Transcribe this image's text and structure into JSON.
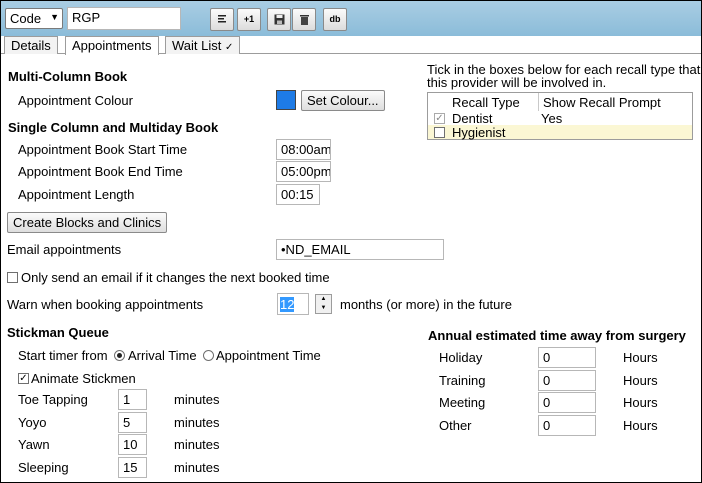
{
  "toolbar": {
    "select_value": "Code",
    "search_value": "RGP",
    "btn2_label": "+1",
    "btn5_label": "db"
  },
  "tabs": [
    "Details",
    "Appointments",
    "Wait List"
  ],
  "wait_list_mark": "✓",
  "multi_column": {
    "heading": "Multi-Column Book",
    "appointment_colour_label": "Appointment Colour",
    "colour_value": "#1e7be6",
    "set_colour_button": "Set Colour..."
  },
  "single_column": {
    "heading": "Single Column and Multiday Book",
    "start_label": "Appointment Book Start Time",
    "start_value": "08:00am",
    "end_label": "Appointment Book End Time",
    "end_value": "05:00pm",
    "length_label": "Appointment Length",
    "length_value": "00:15"
  },
  "create_blocks_button": "Create Blocks and Clinics",
  "email": {
    "label": "Email appointments",
    "value": "•ND_EMAIL",
    "only_send_label": "Only send an email if it changes the next booked time"
  },
  "warn": {
    "label": "Warn when booking appointments",
    "value": "12",
    "suffix": "months (or more) in the future"
  },
  "recall": {
    "instructions_line1": "Tick in the boxes below for each recall type that",
    "instructions_line2": "this provider will be involved in.",
    "col_type": "Recall Type",
    "col_prompt": "Show Recall Prompt",
    "rows": [
      {
        "type": "Dentist",
        "prompt": "Yes",
        "checked": true
      },
      {
        "type": "Hygienist",
        "prompt": "",
        "checked": false
      }
    ]
  },
  "stickman": {
    "heading": "Stickman Queue",
    "start_timer_label": "Start timer from",
    "arrival_label": "Arrival Time",
    "appointment_label": "Appointment Time",
    "animate_label": "Animate Stickmen",
    "rows": [
      {
        "label": "Toe Tapping",
        "value": "1",
        "unit": "minutes"
      },
      {
        "label": "Yoyo",
        "value": "5",
        "unit": "minutes"
      },
      {
        "label": "Yawn",
        "value": "10",
        "unit": "minutes"
      },
      {
        "label": "Sleeping",
        "value": "15",
        "unit": "minutes"
      }
    ]
  },
  "away": {
    "heading": "Annual estimated time away from surgery",
    "rows": [
      {
        "label": "Holiday",
        "value": "0",
        "unit": "Hours"
      },
      {
        "label": "Training",
        "value": "0",
        "unit": "Hours"
      },
      {
        "label": "Meeting",
        "value": "0",
        "unit": "Hours"
      },
      {
        "label": "Other",
        "value": "0",
        "unit": "Hours"
      }
    ]
  }
}
